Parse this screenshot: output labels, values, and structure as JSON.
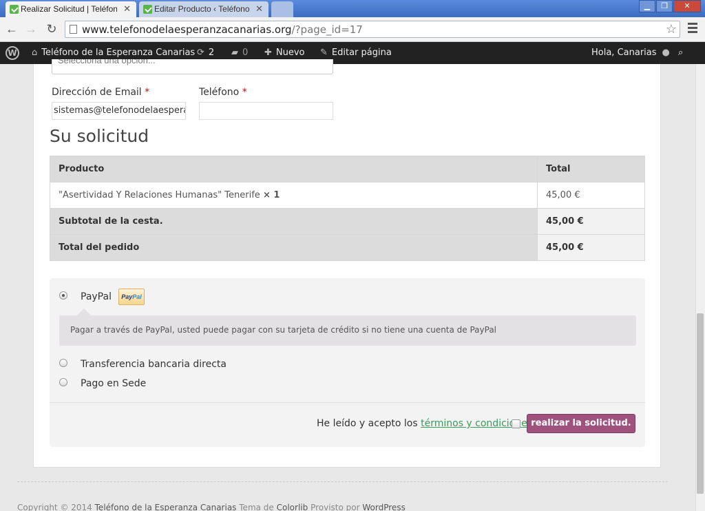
{
  "browser": {
    "tabs": [
      {
        "title": "Realizar Solicitud | Teléfono d",
        "active": true
      },
      {
        "title": "Editar Producto ‹ Teléfono de",
        "active": false
      }
    ],
    "url_host": "www.telefonodelaesperanzacanarias.org",
    "url_path": "/?page_id=17"
  },
  "adminbar": {
    "site_name": "Teléfono de la Esperanza Canarias",
    "updates_count": "2",
    "comments_count": "0",
    "new_label": "Nuevo",
    "edit_label": "Editar página",
    "greeting": "Hola, Canarias"
  },
  "form": {
    "select_placeholder": "Selecciona una opción...",
    "email_label": "Dirección de Email",
    "email_value": "sistemas@telefonodelaesperanzacanarias.org",
    "phone_label": "Teléfono",
    "phone_value": "",
    "required_mark": "*"
  },
  "order": {
    "heading": "Su solicitud",
    "col_product": "Producto",
    "col_total": "Total",
    "item_name": "\"Asertividad Y Relaciones Humanas\" Tenerife",
    "item_qty": "× 1",
    "item_total": "45,00 €",
    "subtotal_label": "Subtotal de la cesta.",
    "subtotal_value": "45,00 €",
    "total_label": "Total del pedido",
    "total_value": "45,00 €"
  },
  "payment": {
    "methods": [
      {
        "label": "PayPal",
        "selected": true
      },
      {
        "label": "Transferencia bancaria directa",
        "selected": false
      },
      {
        "label": "Pago en Sede",
        "selected": false
      }
    ],
    "paypal_badge_pay": "Pay",
    "paypal_badge_pal": "Pal",
    "paypal_description": "Pagar a través de PayPal, usted puede pagar con su tarjeta de crédito si no tiene una cuenta de PayPal",
    "terms_prefix": "He leído y acepto los",
    "terms_link": "términos y condiciones",
    "submit_label": "realizar la solicitud."
  },
  "footer": {
    "copyright": "Copyright © 2014",
    "site_link": "Teléfono de la Esperanza Canarias",
    "theme_text": "Tema de",
    "theme_link": "Colorlib",
    "powered_text": "Provisto por",
    "powered_link": "WordPress"
  }
}
